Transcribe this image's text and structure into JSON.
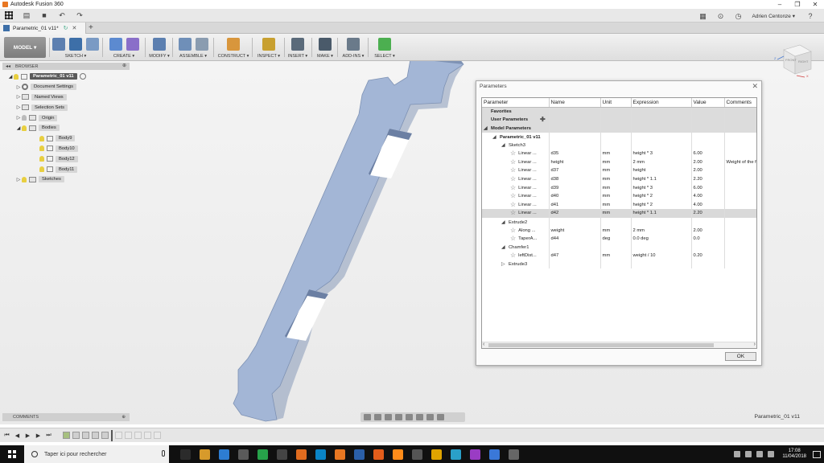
{
  "app_title": "Autodesk Fusion 360",
  "window_controls": [
    "–",
    "❐",
    "✕"
  ],
  "user_name": "Adrien Centonze ▾",
  "doc_tab_label": "Parametric_01 v11*",
  "workspace_label": "MODEL ▾",
  "toolbar_groups": [
    {
      "label": "SKETCH ▾",
      "colors": [
        "#5c7fb0",
        "#3d6fa8",
        "#7a9ac4"
      ]
    },
    {
      "label": "CREATE ▾",
      "colors": [
        "#5c8ad0",
        "#8a6fc9"
      ]
    },
    {
      "label": "MODIFY ▾",
      "colors": [
        "#5c7fb0"
      ]
    },
    {
      "label": "ASSEMBLE ▾",
      "colors": [
        "#6f8fb8",
        "#8a9cb0"
      ]
    },
    {
      "label": "CONSTRUCT ▾",
      "colors": [
        "#d8963c"
      ]
    },
    {
      "label": "INSPECT ▾",
      "colors": [
        "#c8a030"
      ]
    },
    {
      "label": "INSERT ▾",
      "colors": [
        "#5a6a7a"
      ]
    },
    {
      "label": "MAKE ▾",
      "colors": [
        "#4a5a6a"
      ]
    },
    {
      "label": "ADD-INS ▾",
      "colors": [
        "#6a7a8a"
      ]
    },
    {
      "label": "SELECT ▾",
      "colors": [
        "#4caf50"
      ]
    }
  ],
  "browser": {
    "header": "BROWSER",
    "items": [
      {
        "label": "Parametric_01 v11",
        "type": "root"
      },
      {
        "label": "Document Settings",
        "type": "settings"
      },
      {
        "label": "Named Views",
        "type": "folder"
      },
      {
        "label": "Selection Sets",
        "type": "folder"
      },
      {
        "label": "Origin",
        "type": "folder"
      },
      {
        "label": "Bodies",
        "type": "folder"
      },
      {
        "label": "Body9",
        "type": "body"
      },
      {
        "label": "Body10",
        "type": "body"
      },
      {
        "label": "Body12",
        "type": "body"
      },
      {
        "label": "Body11",
        "type": "body"
      },
      {
        "label": "Sketches",
        "type": "folder"
      }
    ]
  },
  "comments_label": "COMMENTS",
  "viewcube_labels": {
    "front": "FRONT",
    "right": "RIGHT"
  },
  "document_name": "Parametric_01 v11",
  "parameters_dialog": {
    "title": "Parameters",
    "columns": [
      "Parameter",
      "Name",
      "Unit",
      "Expression",
      "Value",
      "Comments"
    ],
    "rows": [
      {
        "indent": 0,
        "toggle": "",
        "param": "Favorites",
        "section": true
      },
      {
        "indent": 0,
        "toggle": "",
        "param": "User Parameters",
        "section": true,
        "add": "✚"
      },
      {
        "indent": 0,
        "toggle": "◢",
        "param": "Model Parameters",
        "section": true
      },
      {
        "indent": 1,
        "toggle": "◢",
        "param": "Parametric_01 v11",
        "bold": true
      },
      {
        "indent": 2,
        "toggle": "◢",
        "param": "Sketch3"
      },
      {
        "indent": 3,
        "star": true,
        "param": "Linear ...",
        "name": "d35",
        "unit": "mm",
        "expr": "height * 3",
        "value": "6.00",
        "comment": ""
      },
      {
        "indent": 3,
        "star": true,
        "param": "Linear ...",
        "name": "height",
        "unit": "mm",
        "expr": "2 mm",
        "value": "2.00",
        "comment": "Weight of the f"
      },
      {
        "indent": 3,
        "star": true,
        "param": "Linear ...",
        "name": "d37",
        "unit": "mm",
        "expr": "height",
        "value": "2.00",
        "comment": ""
      },
      {
        "indent": 3,
        "star": true,
        "param": "Linear ...",
        "name": "d38",
        "unit": "mm",
        "expr": "height * 1.1",
        "value": "2.20",
        "comment": ""
      },
      {
        "indent": 3,
        "star": true,
        "param": "Linear ...",
        "name": "d39",
        "unit": "mm",
        "expr": "height * 3",
        "value": "6.00",
        "comment": ""
      },
      {
        "indent": 3,
        "star": true,
        "param": "Linear ...",
        "name": "d40",
        "unit": "mm",
        "expr": "height * 2",
        "value": "4.00",
        "comment": ""
      },
      {
        "indent": 3,
        "star": true,
        "param": "Linear ...",
        "name": "d41",
        "unit": "mm",
        "expr": "height * 2",
        "value": "4.00",
        "comment": ""
      },
      {
        "indent": 3,
        "star": true,
        "param": "Linear ...",
        "name": "d42",
        "unit": "mm",
        "expr": "height * 1.1",
        "value": "2.20",
        "comment": "",
        "selected": true
      },
      {
        "indent": 2,
        "toggle": "◢",
        "param": "Extrude2"
      },
      {
        "indent": 3,
        "star": true,
        "param": "Along ...",
        "name": "weight",
        "unit": "mm",
        "expr": "2 mm",
        "value": "2.00",
        "comment": ""
      },
      {
        "indent": 3,
        "star": true,
        "param": "TaperA...",
        "name": "d44",
        "unit": "deg",
        "expr": "0.0 deg",
        "value": "0.0",
        "comment": ""
      },
      {
        "indent": 2,
        "toggle": "◢",
        "param": "Chamfer1"
      },
      {
        "indent": 3,
        "star": true,
        "param": "leftDist...",
        "name": "d47",
        "unit": "mm",
        "expr": "weight / 10",
        "value": "0.20",
        "comment": ""
      },
      {
        "indent": 2,
        "toggle": "▷",
        "param": "Extrude3"
      }
    ],
    "ok_label": "OK"
  },
  "taskbar": {
    "search_placeholder": "Taper ici pour rechercher",
    "time": "17:08",
    "date": "11/04/2018",
    "app_colors": [
      "#2b2b2b",
      "#d79a2b",
      "#2d7dd2",
      "#5a5a5a",
      "#27a24a",
      "#444",
      "#e06c1f",
      "#0a84c6",
      "#e87722",
      "#2b5fa8",
      "#e35d1b",
      "#ff8c1a",
      "#555",
      "#e0a400",
      "#2aa0c8",
      "#9a3cc4",
      "#3a78d8",
      "#666"
    ]
  },
  "colors": {
    "model_body": "#a3b6d6",
    "model_edge": "#7e92b4"
  }
}
